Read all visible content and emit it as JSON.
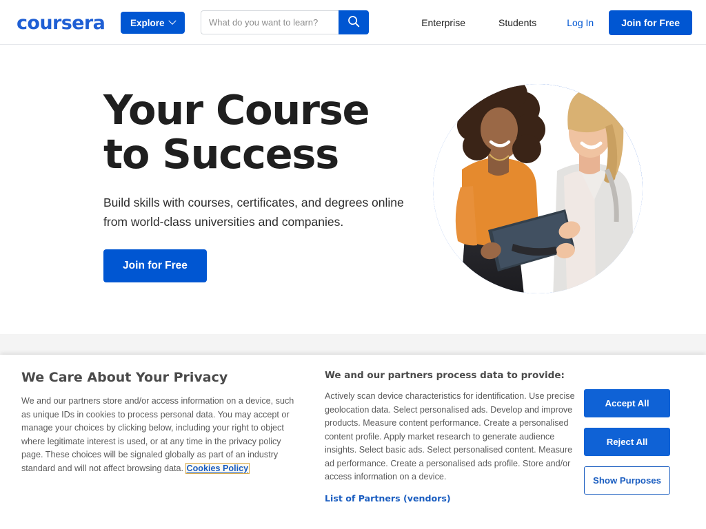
{
  "header": {
    "logo_text": "coursera",
    "explore_label": "Explore",
    "search": {
      "placeholder": "What do you want to learn?",
      "value": "",
      "search_icon": "search-icon"
    },
    "nav": [
      {
        "label": "Enterprise",
        "kind": "link"
      },
      {
        "label": "Students",
        "kind": "link"
      },
      {
        "label": "Log In",
        "kind": "link-accent"
      }
    ],
    "join_label": "Join for Free"
  },
  "hero": {
    "title": "Your Course to Success",
    "subtitle": "Build skills with courses, certificates, and degrees online from world-class universities and companies.",
    "cta_label": "Join for Free",
    "art_alt": "Two women smiling while looking at a tablet, inside a blue circular graphic"
  },
  "cookie_banner": {
    "title": "We Care About Your Privacy",
    "body_before_link": "We and our partners store and/or access information on a device, such as unique IDs in cookies to process personal data. You may accept or manage your choices by clicking below, including your right to object where legitimate interest is used, or at any time in the privacy policy page. These choices will be signaled globally as part of an industry standard and will not affect browsing data. ",
    "policy_link": "Cookies Policy",
    "purposes_title": "We and our partners process data to provide:",
    "purposes_body": "Actively scan device characteristics for identification. Use precise geolocation data. Select personalised ads. Develop and improve products. Measure content performance. Create a personalised content profile. Apply market research to generate audience insights. Select basic ads. Select personalised content. Measure ad performance. Create a personalised ads profile. Store and/or access information on a device.",
    "partners_link": "List of Partners (vendors)",
    "accept_label": "Accept All",
    "reject_label": "Reject All",
    "show_purposes_label": "Show Purposes"
  },
  "colors": {
    "brand_blue": "#0056D2",
    "logo_blue": "#1f5fd4",
    "art_blue": "#1055ce",
    "banner_button_blue": "#0f62d6",
    "link_blue": "#1a5dc0",
    "focus_outline": "#d7a948",
    "gray_band": "#f4f4f4",
    "text_dark": "#1f1f1f",
    "text_muted": "#5a5a5a"
  }
}
